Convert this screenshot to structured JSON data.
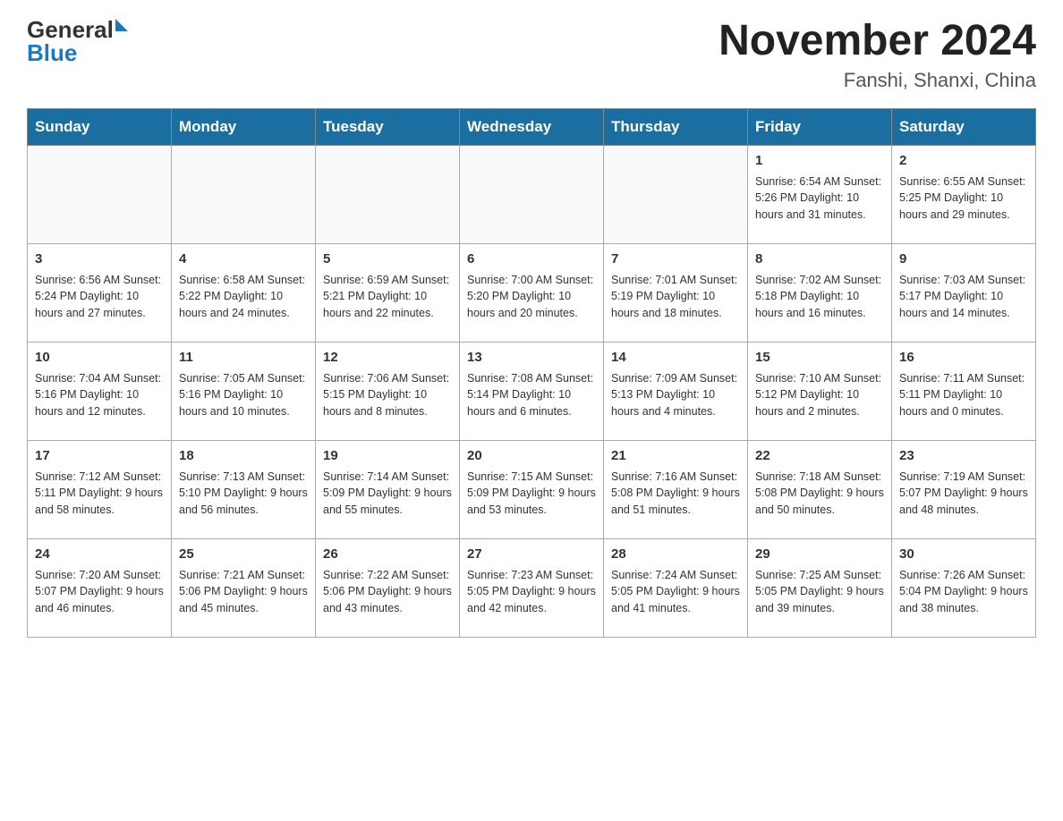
{
  "header": {
    "logo_general": "General",
    "logo_blue": "Blue",
    "month_year": "November 2024",
    "location": "Fanshi, Shanxi, China"
  },
  "days_of_week": [
    "Sunday",
    "Monday",
    "Tuesday",
    "Wednesday",
    "Thursday",
    "Friday",
    "Saturday"
  ],
  "weeks": [
    {
      "days": [
        {
          "num": "",
          "detail": ""
        },
        {
          "num": "",
          "detail": ""
        },
        {
          "num": "",
          "detail": ""
        },
        {
          "num": "",
          "detail": ""
        },
        {
          "num": "",
          "detail": ""
        },
        {
          "num": "1",
          "detail": "Sunrise: 6:54 AM\nSunset: 5:26 PM\nDaylight: 10 hours\nand 31 minutes."
        },
        {
          "num": "2",
          "detail": "Sunrise: 6:55 AM\nSunset: 5:25 PM\nDaylight: 10 hours\nand 29 minutes."
        }
      ]
    },
    {
      "days": [
        {
          "num": "3",
          "detail": "Sunrise: 6:56 AM\nSunset: 5:24 PM\nDaylight: 10 hours\nand 27 minutes."
        },
        {
          "num": "4",
          "detail": "Sunrise: 6:58 AM\nSunset: 5:22 PM\nDaylight: 10 hours\nand 24 minutes."
        },
        {
          "num": "5",
          "detail": "Sunrise: 6:59 AM\nSunset: 5:21 PM\nDaylight: 10 hours\nand 22 minutes."
        },
        {
          "num": "6",
          "detail": "Sunrise: 7:00 AM\nSunset: 5:20 PM\nDaylight: 10 hours\nand 20 minutes."
        },
        {
          "num": "7",
          "detail": "Sunrise: 7:01 AM\nSunset: 5:19 PM\nDaylight: 10 hours\nand 18 minutes."
        },
        {
          "num": "8",
          "detail": "Sunrise: 7:02 AM\nSunset: 5:18 PM\nDaylight: 10 hours\nand 16 minutes."
        },
        {
          "num": "9",
          "detail": "Sunrise: 7:03 AM\nSunset: 5:17 PM\nDaylight: 10 hours\nand 14 minutes."
        }
      ]
    },
    {
      "days": [
        {
          "num": "10",
          "detail": "Sunrise: 7:04 AM\nSunset: 5:16 PM\nDaylight: 10 hours\nand 12 minutes."
        },
        {
          "num": "11",
          "detail": "Sunrise: 7:05 AM\nSunset: 5:16 PM\nDaylight: 10 hours\nand 10 minutes."
        },
        {
          "num": "12",
          "detail": "Sunrise: 7:06 AM\nSunset: 5:15 PM\nDaylight: 10 hours\nand 8 minutes."
        },
        {
          "num": "13",
          "detail": "Sunrise: 7:08 AM\nSunset: 5:14 PM\nDaylight: 10 hours\nand 6 minutes."
        },
        {
          "num": "14",
          "detail": "Sunrise: 7:09 AM\nSunset: 5:13 PM\nDaylight: 10 hours\nand 4 minutes."
        },
        {
          "num": "15",
          "detail": "Sunrise: 7:10 AM\nSunset: 5:12 PM\nDaylight: 10 hours\nand 2 minutes."
        },
        {
          "num": "16",
          "detail": "Sunrise: 7:11 AM\nSunset: 5:11 PM\nDaylight: 10 hours\nand 0 minutes."
        }
      ]
    },
    {
      "days": [
        {
          "num": "17",
          "detail": "Sunrise: 7:12 AM\nSunset: 5:11 PM\nDaylight: 9 hours\nand 58 minutes."
        },
        {
          "num": "18",
          "detail": "Sunrise: 7:13 AM\nSunset: 5:10 PM\nDaylight: 9 hours\nand 56 minutes."
        },
        {
          "num": "19",
          "detail": "Sunrise: 7:14 AM\nSunset: 5:09 PM\nDaylight: 9 hours\nand 55 minutes."
        },
        {
          "num": "20",
          "detail": "Sunrise: 7:15 AM\nSunset: 5:09 PM\nDaylight: 9 hours\nand 53 minutes."
        },
        {
          "num": "21",
          "detail": "Sunrise: 7:16 AM\nSunset: 5:08 PM\nDaylight: 9 hours\nand 51 minutes."
        },
        {
          "num": "22",
          "detail": "Sunrise: 7:18 AM\nSunset: 5:08 PM\nDaylight: 9 hours\nand 50 minutes."
        },
        {
          "num": "23",
          "detail": "Sunrise: 7:19 AM\nSunset: 5:07 PM\nDaylight: 9 hours\nand 48 minutes."
        }
      ]
    },
    {
      "days": [
        {
          "num": "24",
          "detail": "Sunrise: 7:20 AM\nSunset: 5:07 PM\nDaylight: 9 hours\nand 46 minutes."
        },
        {
          "num": "25",
          "detail": "Sunrise: 7:21 AM\nSunset: 5:06 PM\nDaylight: 9 hours\nand 45 minutes."
        },
        {
          "num": "26",
          "detail": "Sunrise: 7:22 AM\nSunset: 5:06 PM\nDaylight: 9 hours\nand 43 minutes."
        },
        {
          "num": "27",
          "detail": "Sunrise: 7:23 AM\nSunset: 5:05 PM\nDaylight: 9 hours\nand 42 minutes."
        },
        {
          "num": "28",
          "detail": "Sunrise: 7:24 AM\nSunset: 5:05 PM\nDaylight: 9 hours\nand 41 minutes."
        },
        {
          "num": "29",
          "detail": "Sunrise: 7:25 AM\nSunset: 5:05 PM\nDaylight: 9 hours\nand 39 minutes."
        },
        {
          "num": "30",
          "detail": "Sunrise: 7:26 AM\nSunset: 5:04 PM\nDaylight: 9 hours\nand 38 minutes."
        }
      ]
    }
  ]
}
